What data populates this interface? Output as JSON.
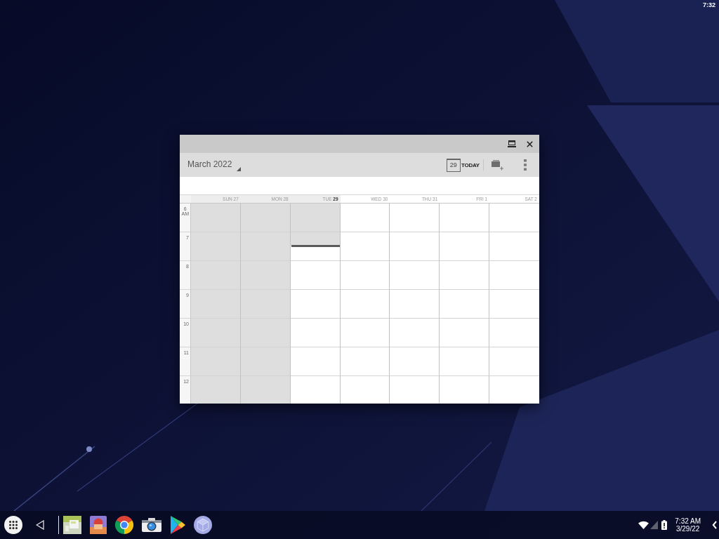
{
  "status_bar": {
    "time": "7:32"
  },
  "window": {
    "toolbar": {
      "month": "March 2022",
      "today_date": "29",
      "today_label": "TODAY"
    },
    "days": [
      {
        "name": "SUN",
        "date": "27",
        "past": true,
        "today": false
      },
      {
        "name": "MON",
        "date": "28",
        "past": true,
        "today": false
      },
      {
        "name": "TUE",
        "date": "29",
        "past": false,
        "today": true
      },
      {
        "name": "WED",
        "date": "30",
        "past": false,
        "today": false
      },
      {
        "name": "THU",
        "date": "31",
        "past": false,
        "today": false
      },
      {
        "name": "FRI",
        "date": "1",
        "past": false,
        "today": false
      },
      {
        "name": "SAT",
        "date": "2",
        "past": false,
        "today": false
      }
    ],
    "hours": [
      {
        "label": "6",
        "suffix": "AM"
      },
      {
        "label": "7"
      },
      {
        "label": "8"
      },
      {
        "label": "9"
      },
      {
        "label": "10"
      },
      {
        "label": "11"
      },
      {
        "label": "12"
      }
    ]
  },
  "taskbar": {
    "time": "7:32 AM",
    "date": "3/29/22"
  }
}
